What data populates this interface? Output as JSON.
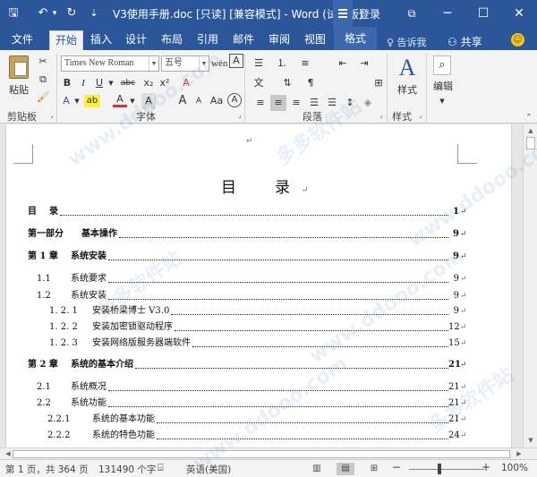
{
  "app": {
    "title": "V3使用手册.doc [只读] [兼容模式] - Word (试用版)",
    "login": "登录"
  },
  "quick_access": {
    "save": "🖫",
    "undo": "↶",
    "undo_dropdown": "▾",
    "redo": "↻",
    "customize": "⇣"
  },
  "window_controls": {
    "restore_ribbon": "⧉",
    "minimize": "─",
    "maximize": "☐",
    "close": "✕"
  },
  "tabs": [
    {
      "label": "文件"
    },
    {
      "label": "开始"
    },
    {
      "label": "插入"
    },
    {
      "label": "设计"
    },
    {
      "label": "布局"
    },
    {
      "label": "引用"
    },
    {
      "label": "邮件"
    },
    {
      "label": "审阅"
    },
    {
      "label": "视图"
    }
  ],
  "contextual_tab": "格式",
  "tell_me": "♀ 告诉我",
  "share": "⚇ 共享",
  "ribbon": {
    "clipboard": {
      "label": "剪贴板",
      "paste": "粘贴"
    },
    "font": {
      "label": "字体",
      "font_name": "Times New Roman",
      "font_size": "五号",
      "bold": "B",
      "italic": "I",
      "underline": "U",
      "strike": "abc",
      "subscript": "x₂",
      "superscript": "x²",
      "grow": "A",
      "shrink": "A",
      "case": "Aa",
      "clear": "A",
      "char_border": "A",
      "highlight": "ab",
      "font_color": "A",
      "phonetic": "wén",
      "char_shading": "A",
      "enclose": "A"
    },
    "paragraph": {
      "label": "段落"
    },
    "styles": {
      "label": "样式",
      "button": "样式"
    },
    "editing": {
      "button": "编辑"
    }
  },
  "document": {
    "toc_title": "目　录",
    "para_mark": "↵",
    "entries": [
      {
        "num": "目",
        "text": "录",
        "page": "1",
        "bold": true
      },
      {
        "num": "第一部分",
        "text": "基本操作",
        "page": "9",
        "bold": true
      },
      {
        "num": "第 1 章",
        "text": "系统安装",
        "page": "9",
        "bold": true
      },
      {
        "num": "1.1",
        "text": "系统要求",
        "page": "9",
        "bold": false
      },
      {
        "num": "1.2",
        "text": "系统安装",
        "page": "9",
        "bold": false
      },
      {
        "num": "1. 2. 1",
        "text": "安装桥梁博士 V3.0",
        "page": "9",
        "bold": false
      },
      {
        "num": "1. 2. 2",
        "text": "安装加密锁驱动程序",
        "page": "12",
        "bold": false
      },
      {
        "num": "1. 2. 3",
        "text": "安装网络版服务器端软件",
        "page": "15",
        "bold": false
      },
      {
        "num": "第 2 章",
        "text": "系统的基本介绍",
        "page": "21",
        "bold": true
      },
      {
        "num": "2.1",
        "text": "系统概况",
        "page": "21",
        "bold": false
      },
      {
        "num": "2.2",
        "text": "系统功能",
        "page": "21",
        "bold": false
      },
      {
        "num": "2.2.1",
        "text": "系统的基本功能",
        "page": "21",
        "bold": false
      },
      {
        "num": "2.2.2",
        "text": "系统的特色功能",
        "page": "24",
        "bold": false
      }
    ]
  },
  "status": {
    "page": "第 1 页，共 364 页",
    "words": "131490 个字",
    "language": "英语(美国)",
    "zoom_minus": "−",
    "zoom_plus": "+",
    "zoom": "100%",
    "zoom_level": 1.0
  },
  "watermark": "多多软件站",
  "watermark_url": "www.ddooo.com",
  "colors": {
    "accent": "#2b579a",
    "contextual": "#3b68ad"
  }
}
